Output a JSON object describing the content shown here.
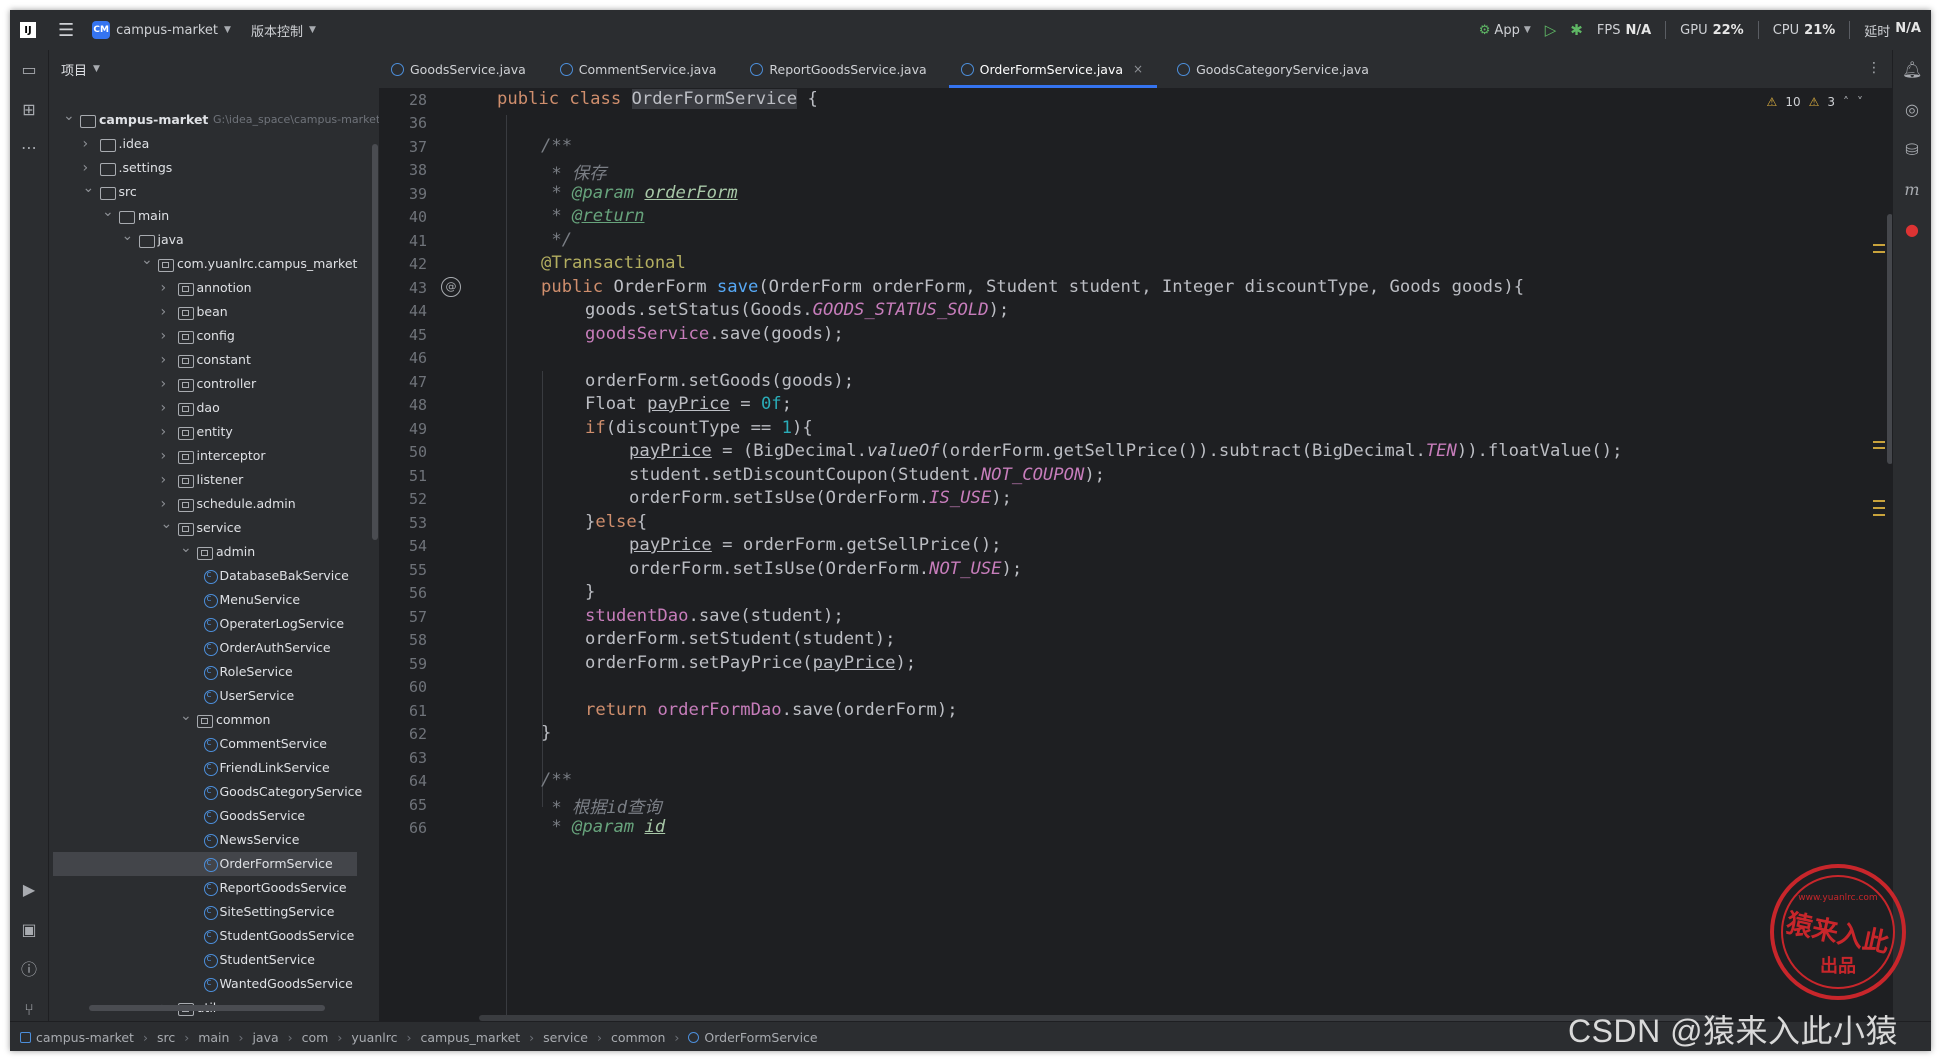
{
  "titlebar": {
    "project_badge": "CM",
    "project_name": "campus-market",
    "vcs": "版本控制",
    "run_config": "App",
    "fps_label": "FPS",
    "fps_value": "N/A",
    "gpu_label": "GPU",
    "gpu_value": "22%",
    "cpu_label": "CPU",
    "cpu_value": "21%",
    "time_label": "延时",
    "time_value": "N/A"
  },
  "panel": {
    "title": "项目",
    "root_name": "campus-market",
    "root_path": "G:\\idea_space\\campus-market",
    "tree": [
      {
        "label": "campus-market",
        "level": 0,
        "kind": "root",
        "expanded": true
      },
      {
        "label": ".idea",
        "level": 1,
        "kind": "folder",
        "expanded": false
      },
      {
        "label": ".settings",
        "level": 1,
        "kind": "folder",
        "expanded": false
      },
      {
        "label": "src",
        "level": 1,
        "kind": "folder",
        "expanded": true
      },
      {
        "label": "main",
        "level": 2,
        "kind": "folder",
        "expanded": true
      },
      {
        "label": "java",
        "level": 3,
        "kind": "folder",
        "expanded": true
      },
      {
        "label": "com.yuanlrc.campus_market",
        "level": 4,
        "kind": "package",
        "expanded": true
      },
      {
        "label": "annotion",
        "level": 5,
        "kind": "package",
        "expanded": false
      },
      {
        "label": "bean",
        "level": 5,
        "kind": "package",
        "expanded": false
      },
      {
        "label": "config",
        "level": 5,
        "kind": "package",
        "expanded": false
      },
      {
        "label": "constant",
        "level": 5,
        "kind": "package",
        "expanded": false
      },
      {
        "label": "controller",
        "level": 5,
        "kind": "package",
        "expanded": false
      },
      {
        "label": "dao",
        "level": 5,
        "kind": "package",
        "expanded": false
      },
      {
        "label": "entity",
        "level": 5,
        "kind": "package",
        "expanded": false
      },
      {
        "label": "interceptor",
        "level": 5,
        "kind": "package",
        "expanded": false
      },
      {
        "label": "listener",
        "level": 5,
        "kind": "package",
        "expanded": false
      },
      {
        "label": "schedule.admin",
        "level": 5,
        "kind": "package",
        "expanded": false
      },
      {
        "label": "service",
        "level": 5,
        "kind": "package",
        "expanded": true
      },
      {
        "label": "admin",
        "level": 6,
        "kind": "package",
        "expanded": true
      },
      {
        "label": "DatabaseBakService",
        "level": 7,
        "kind": "class"
      },
      {
        "label": "MenuService",
        "level": 7,
        "kind": "class"
      },
      {
        "label": "OperaterLogService",
        "level": 7,
        "kind": "class"
      },
      {
        "label": "OrderAuthService",
        "level": 7,
        "kind": "class"
      },
      {
        "label": "RoleService",
        "level": 7,
        "kind": "class"
      },
      {
        "label": "UserService",
        "level": 7,
        "kind": "class"
      },
      {
        "label": "common",
        "level": 6,
        "kind": "package",
        "expanded": true
      },
      {
        "label": "CommentService",
        "level": 7,
        "kind": "class"
      },
      {
        "label": "FriendLinkService",
        "level": 7,
        "kind": "class"
      },
      {
        "label": "GoodsCategoryService",
        "level": 7,
        "kind": "class"
      },
      {
        "label": "GoodsService",
        "level": 7,
        "kind": "class"
      },
      {
        "label": "NewsService",
        "level": 7,
        "kind": "class"
      },
      {
        "label": "OrderFormService",
        "level": 7,
        "kind": "class",
        "selected": true
      },
      {
        "label": "ReportGoodsService",
        "level": 7,
        "kind": "class"
      },
      {
        "label": "SiteSettingService",
        "level": 7,
        "kind": "class"
      },
      {
        "label": "StudentGoodsService",
        "level": 7,
        "kind": "class"
      },
      {
        "label": "StudentService",
        "level": 7,
        "kind": "class"
      },
      {
        "label": "WantedGoodsService",
        "level": 7,
        "kind": "class"
      },
      {
        "label": "util",
        "level": 5,
        "kind": "package",
        "expanded": false
      }
    ]
  },
  "tabs": [
    {
      "label": "GoodsService.java",
      "active": false
    },
    {
      "label": "CommentService.java",
      "active": false
    },
    {
      "label": "ReportGoodsService.java",
      "active": false
    },
    {
      "label": "OrderFormService.java",
      "active": true
    },
    {
      "label": "GoodsCategoryService.java",
      "active": false
    }
  ],
  "editor": {
    "warnings": "10",
    "weak_warnings": "3",
    "sticky_line": "28",
    "lines": [
      "28",
      "36",
      "37",
      "38",
      "39",
      "40",
      "41",
      "42",
      "43",
      "44",
      "45",
      "46",
      "47",
      "48",
      "49",
      "50",
      "51",
      "52",
      "53",
      "54",
      "55",
      "56",
      "57",
      "58",
      "59",
      "60",
      "61",
      "62",
      "63",
      "64",
      "65",
      "66"
    ]
  },
  "statusbar": {
    "crumbs": [
      "campus-market",
      "src",
      "main",
      "java",
      "com",
      "yuanlrc",
      "campus_market",
      "service",
      "common",
      "OrderFormService"
    ]
  },
  "watermark": {
    "csdn": "CSDN @猿来入此小猿",
    "stamp_url": "www.yuanlrc.com",
    "stamp_main": "猿来入此",
    "stamp_sub": "出品"
  },
  "colors": {
    "accent": "#3574f0",
    "background": "#1e1f22",
    "panel": "#2b2d30",
    "keyword": "#cf8e6d",
    "method": "#56a8f5",
    "field": "#c77dbb",
    "comment": "#7a7e85",
    "annotation": "#b3ae60",
    "number": "#2aacb8"
  }
}
